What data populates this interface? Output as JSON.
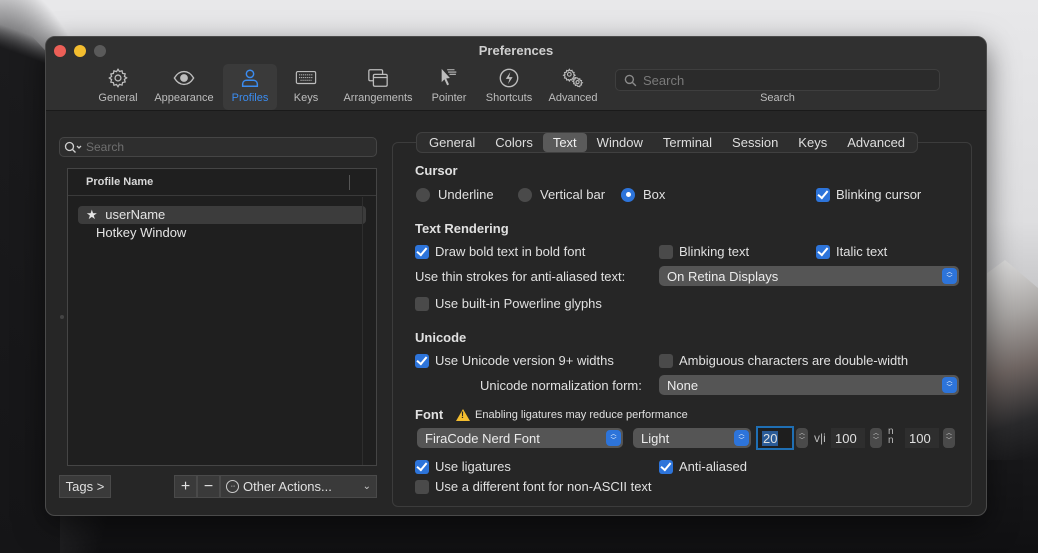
{
  "window": {
    "title": "Preferences"
  },
  "toolbar": {
    "items": [
      {
        "label": "General",
        "icon": "gear-icon",
        "active": false
      },
      {
        "label": "Appearance",
        "icon": "eye-icon",
        "active": false
      },
      {
        "label": "Profiles",
        "icon": "person-icon",
        "active": true
      },
      {
        "label": "Keys",
        "icon": "keyboard-icon",
        "active": false
      },
      {
        "label": "Arrangements",
        "icon": "windows-icon",
        "active": false
      },
      {
        "label": "Pointer",
        "icon": "pointer-icon",
        "active": false
      },
      {
        "label": "Shortcuts",
        "icon": "lightning-icon",
        "active": false
      },
      {
        "label": "Advanced",
        "icon": "gears-icon",
        "active": false
      }
    ],
    "search_placeholder": "Search",
    "search_label": "Search"
  },
  "profiles": {
    "search_placeholder": "Search",
    "column_header": "Profile Name",
    "rows": [
      {
        "name": "userName",
        "default": true,
        "selected": true
      },
      {
        "name": "Hotkey Window",
        "default": false,
        "selected": false
      }
    ],
    "tags_label": "Tags >",
    "add_label": "+",
    "remove_label": "−",
    "other_actions_label": "Other Actions...",
    "star_glyph": "★"
  },
  "tabs": [
    {
      "label": "General",
      "active": false
    },
    {
      "label": "Colors",
      "active": false
    },
    {
      "label": "Text",
      "active": true
    },
    {
      "label": "Window",
      "active": false
    },
    {
      "label": "Terminal",
      "active": false
    },
    {
      "label": "Session",
      "active": false
    },
    {
      "label": "Keys",
      "active": false
    },
    {
      "label": "Advanced",
      "active": false
    }
  ],
  "cursor": {
    "title": "Cursor",
    "options": [
      {
        "label": "Underline",
        "selected": false
      },
      {
        "label": "Vertical bar",
        "selected": false
      },
      {
        "label": "Box",
        "selected": true
      }
    ],
    "blinking_label": "Blinking cursor",
    "blinking": true
  },
  "text_rendering": {
    "title": "Text Rendering",
    "bold_label": "Draw bold text in bold font",
    "bold": true,
    "blinking_text_label": "Blinking text",
    "blinking_text": false,
    "italic_label": "Italic text",
    "italic": true,
    "thin_strokes_label": "Use thin strokes for anti-aliased text:",
    "thin_strokes_value": "On Retina Displays",
    "powerline_label": "Use built-in Powerline glyphs",
    "powerline": false
  },
  "unicode": {
    "title": "Unicode",
    "v9_label": "Use Unicode version 9+ widths",
    "v9": true,
    "ambiguous_label": "Ambiguous characters are double-width",
    "ambiguous": false,
    "normalization_label": "Unicode normalization form:",
    "normalization_value": "None"
  },
  "font": {
    "title": "Font",
    "warning": "Enabling ligatures may reduce performance",
    "family": "FiraCode Nerd Font",
    "weight": "Light",
    "size": "20",
    "horizontal_spacing_icon": "v|i",
    "horizontal_spacing": "100",
    "vertical_spacing_icon": "n/n",
    "vertical_spacing": "100",
    "ligatures_label": "Use ligatures",
    "ligatures": true,
    "antialiased_label": "Anti-aliased",
    "antialiased": true,
    "non_ascii_label": "Use a different font for non-ASCII text",
    "non_ascii": false
  },
  "colors": {
    "accent": "#2d74da",
    "active_tab_text": "#3b8cf0",
    "close": "#ec5f57",
    "minimize": "#f3bd2f",
    "warning": "#f3bd2f"
  }
}
